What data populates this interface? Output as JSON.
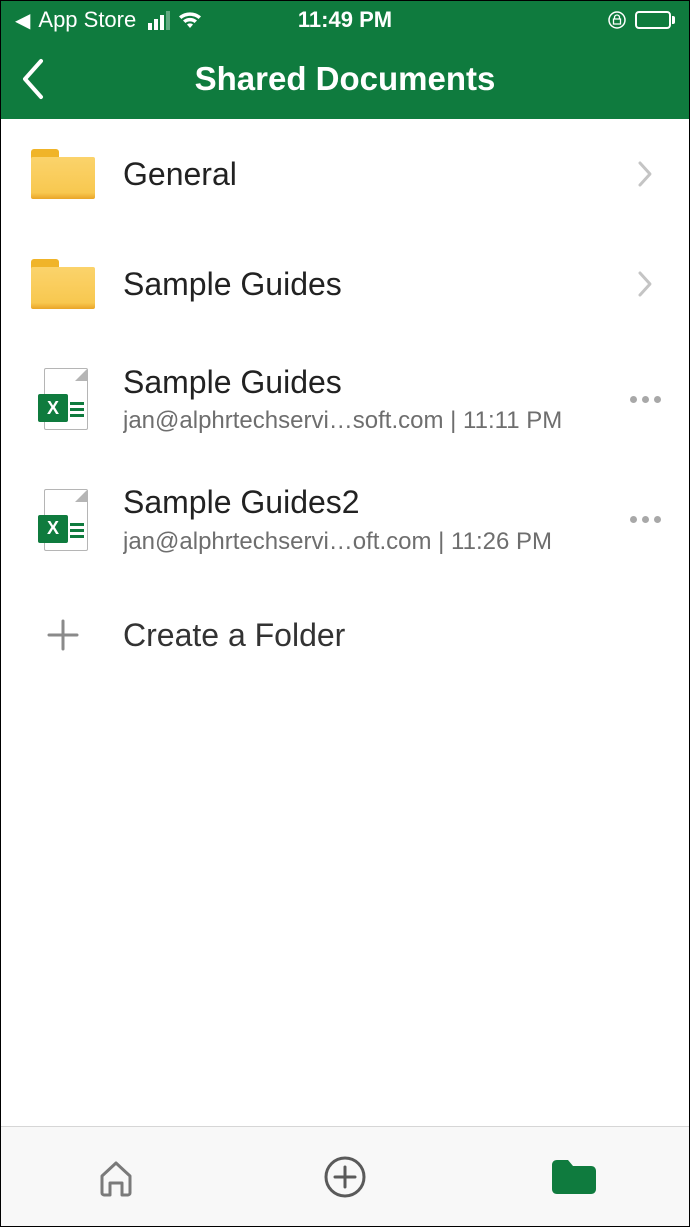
{
  "status_bar": {
    "back_app": "App Store",
    "time": "11:49 PM"
  },
  "header": {
    "title": "Shared Documents"
  },
  "items": [
    {
      "type": "folder",
      "title": "General",
      "action": "chevron"
    },
    {
      "type": "folder",
      "title": "Sample Guides",
      "action": "chevron"
    },
    {
      "type": "file",
      "title": "Sample Guides",
      "subtitle": "jan@alphrtechservi…soft.com | 11:11 PM",
      "action": "more"
    },
    {
      "type": "file",
      "title": "Sample Guides2",
      "subtitle": "jan@alphrtechservi…oft.com | 11:26 PM",
      "action": "more"
    }
  ],
  "create_folder": {
    "label": "Create a Folder"
  }
}
